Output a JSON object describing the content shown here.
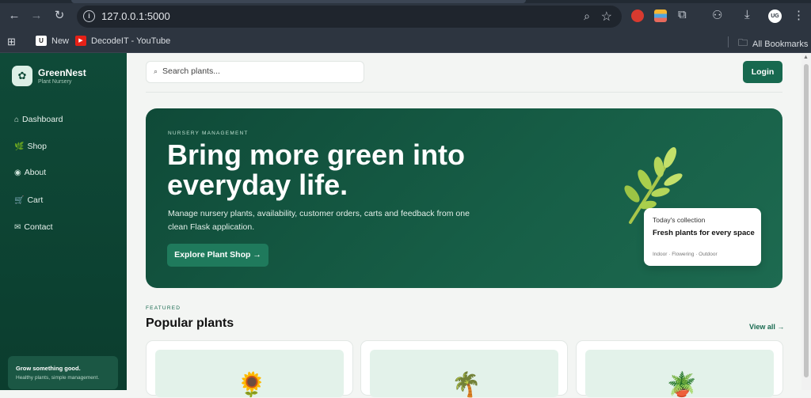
{
  "browser": {
    "url": "127.0.0.1:5000",
    "profile_initials": "UG",
    "bookmarks": [
      {
        "label": "New"
      },
      {
        "label": "DecodeIT - YouTube"
      }
    ],
    "all_bookmarks_label": "All Bookmarks"
  },
  "sidebar": {
    "brand_name": "GreenNest",
    "brand_sub": "Plant Nursery",
    "items": [
      {
        "icon": "⌂",
        "label": "Dashboard"
      },
      {
        "icon": "🌿",
        "label": "Shop"
      },
      {
        "icon": "◉",
        "label": "About"
      },
      {
        "icon": "🛒",
        "label": "Cart"
      },
      {
        "icon": "✉",
        "label": "Contact"
      }
    ],
    "card_title": "Grow something good.",
    "card_sub": "Healthy plants, simple management."
  },
  "header": {
    "search_placeholder": "Search plants...",
    "login_label": "Login"
  },
  "hero": {
    "eyebrow": "NURSERY MANAGEMENT",
    "title": "Bring more green into everyday life.",
    "description": "Manage nursery plants, availability, customer orders, carts and feedback from one clean Flask application.",
    "cta_label": "Explore Plant Shop →",
    "collection": {
      "label": "Today's collection",
      "title": "Fresh plants for every space",
      "tags": "Indoor · Flowering · Outdoor"
    }
  },
  "featured": {
    "eyebrow": "FEATURED",
    "title": "Popular plants",
    "view_all_label": "View all →",
    "cards": [
      {
        "emoji": "🌻"
      },
      {
        "emoji": "🌴"
      },
      {
        "emoji": "🪴"
      }
    ]
  },
  "colors": {
    "brand_dark": "#0f4a38",
    "accent": "#17694f"
  }
}
